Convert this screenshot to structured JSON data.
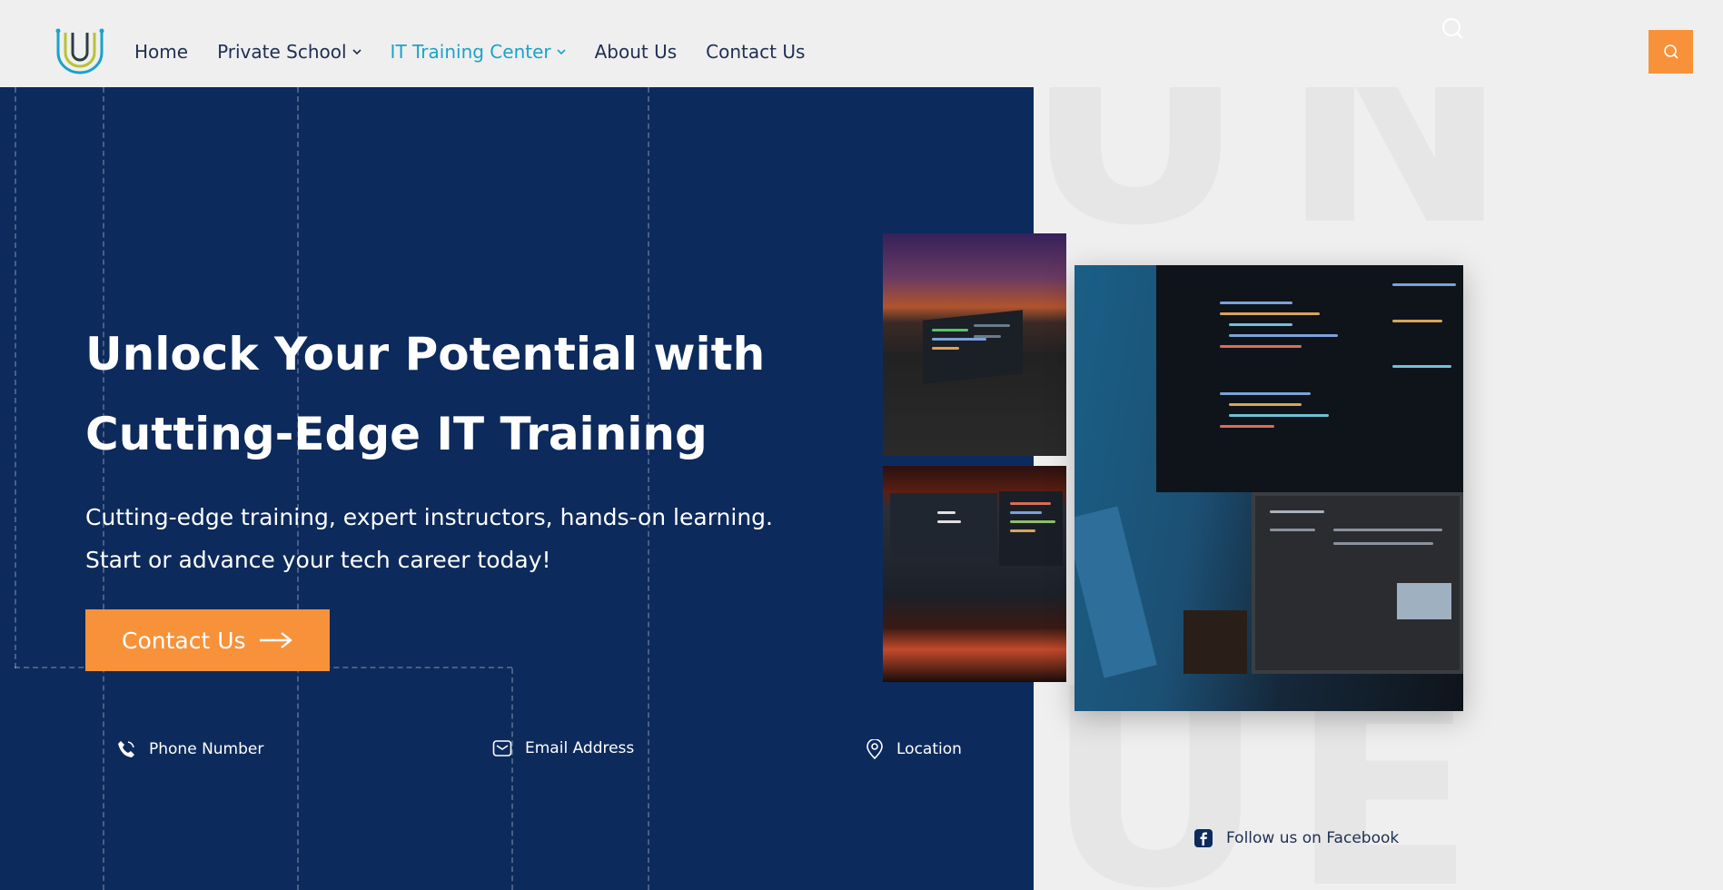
{
  "nav": {
    "items": [
      {
        "label": "Home",
        "active": false,
        "has_dropdown": false
      },
      {
        "label": "Private School",
        "active": false,
        "has_dropdown": true
      },
      {
        "label": "IT Training Center",
        "active": true,
        "has_dropdown": true
      },
      {
        "label": "About Us",
        "active": false,
        "has_dropdown": false
      },
      {
        "label": "Contact Us",
        "active": false,
        "has_dropdown": false
      }
    ]
  },
  "hero": {
    "title_line1": "Unlock Your Potential with",
    "title_line2": "Cutting-Edge IT Training",
    "subtitle_line1": "Cutting-edge training, expert instructors, hands-on learning.",
    "subtitle_line2": "Start or advance your tech career today!",
    "cta_label": "Contact Us"
  },
  "contact_bar": {
    "phone_label": "Phone Number",
    "email_label": "Email Address",
    "location_label": "Location",
    "facebook_label": "Follow us on Facebook"
  },
  "icons": {
    "logo": "logo-u-icon",
    "search": "search-icon",
    "phone": "phone-icon",
    "email": "email-icon",
    "location": "location-pin-icon",
    "facebook": "facebook-icon",
    "arrow": "arrow-right-icon",
    "chevron": "chevron-down-icon"
  },
  "watermark": {
    "letters": [
      "U",
      "N",
      "U",
      "E"
    ]
  },
  "colors": {
    "navy": "#0d2a5c",
    "orange": "#f7923a",
    "nav_active": "#1aa3c9",
    "background": "#efefef",
    "watermark": "#e6e6e6"
  }
}
